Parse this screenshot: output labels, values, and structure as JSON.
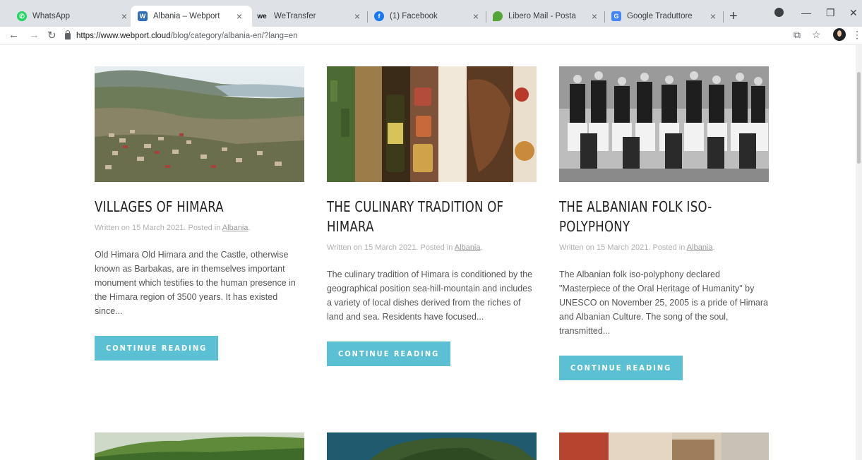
{
  "tabs": [
    {
      "title": "WhatsApp",
      "favicon": "whatsapp-icon",
      "color": "#25d366"
    },
    {
      "title": "Albania – Webport",
      "favicon": "webport-w-icon",
      "color": "#2f6db5"
    },
    {
      "title": "WeTransfer",
      "favicon": "wetransfer-icon",
      "color": "#17181a"
    },
    {
      "title": "(1) Facebook",
      "favicon": "facebook-icon",
      "color": "#1877f2"
    },
    {
      "title": "Libero Mail - Posta",
      "favicon": "libero-icon",
      "color": "#54a437"
    },
    {
      "title": "Google Traduttore",
      "favicon": "google-translate-icon",
      "color": "#4285f4"
    }
  ],
  "address": {
    "host": "https://www.webport.cloud",
    "path": "/blog/category/albania-en/?lang=en"
  },
  "posts": [
    {
      "title": "VILLAGES OF HIMARA",
      "meta_prefix": "Written on 15 March 2021. Posted in",
      "category": "Albania",
      "meta_suffix": ".",
      "excerpt": "Old Himara  Old Himara and the Castle, otherwise known as Barbakas, are in themselves important monument which testifies to the human presence in the Himara region of 3500 years. It has existed since...",
      "button": "CONTINUE READING"
    },
    {
      "title": "THE CULINARY TRADITION OF HIMARA",
      "meta_prefix": "Written on 15 March 2021. Posted in",
      "category": "Albania",
      "meta_suffix": ".",
      "excerpt": "The culinary tradition of Himara is conditioned by the geographical position sea-hill-mountain and includes a variety of local dishes derived from the riches of land and sea. Residents have focused...",
      "button": "CONTINUE READING"
    },
    {
      "title": "THE ALBANIAN FOLK ISO-POLYPHONY",
      "meta_prefix": "Written on 15 March 2021. Posted in",
      "category": "Albania",
      "meta_suffix": ".",
      "excerpt": "The Albanian folk iso-polyphony declared \"Masterpiece of the Oral Heritage of Humanity\" by UNESCO on November 25, 2005 is a pride of Himara and Albanian Culture. The song of the soul, transmitted...",
      "button": "CONTINUE READING"
    }
  ],
  "colors": {
    "accent": "#5bc0d3",
    "tabbar": "#dee1e6"
  }
}
